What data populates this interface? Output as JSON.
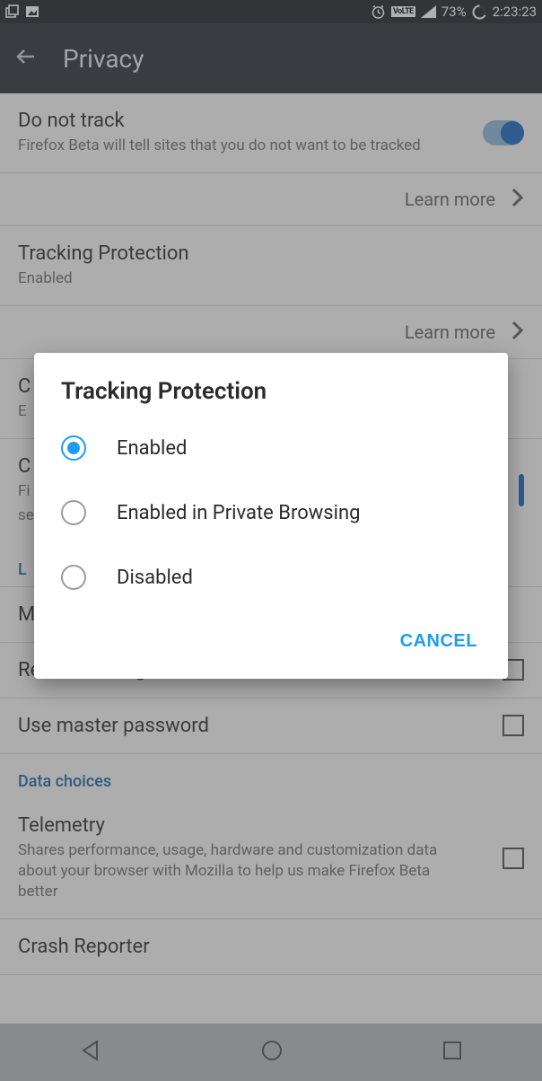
{
  "status": {
    "battery": "73%",
    "time": "2:23:23"
  },
  "appbar": {
    "title": "Privacy"
  },
  "settings": {
    "dnt": {
      "title": "Do not track",
      "sub": "Firefox Beta will tell sites that you do not want to be tracked"
    },
    "learn": "Learn more",
    "tp": {
      "title": "Tracking Protection",
      "sub": "Enabled"
    },
    "cookies_hdr": "C",
    "cookies_sub": "E",
    "clear_title": "C",
    "clear_sub_a": "Fi",
    "clear_sub_b": "se",
    "logins_hdr": "L",
    "manage_title": "M",
    "remember_title": "Remember logins",
    "master_title": "Use master password",
    "data_hdr": "Data choices",
    "telemetry_title": "Telemetry",
    "telemetry_sub": "Shares performance, usage, hardware and customization data about your browser with Mozilla to help us make Firefox Beta better",
    "crash_title": "Crash Reporter"
  },
  "dialog": {
    "title": "Tracking Protection",
    "opt1": "Enabled",
    "opt2": "Enabled in Private Browsing",
    "opt3": "Disabled",
    "cancel": "CANCEL"
  }
}
